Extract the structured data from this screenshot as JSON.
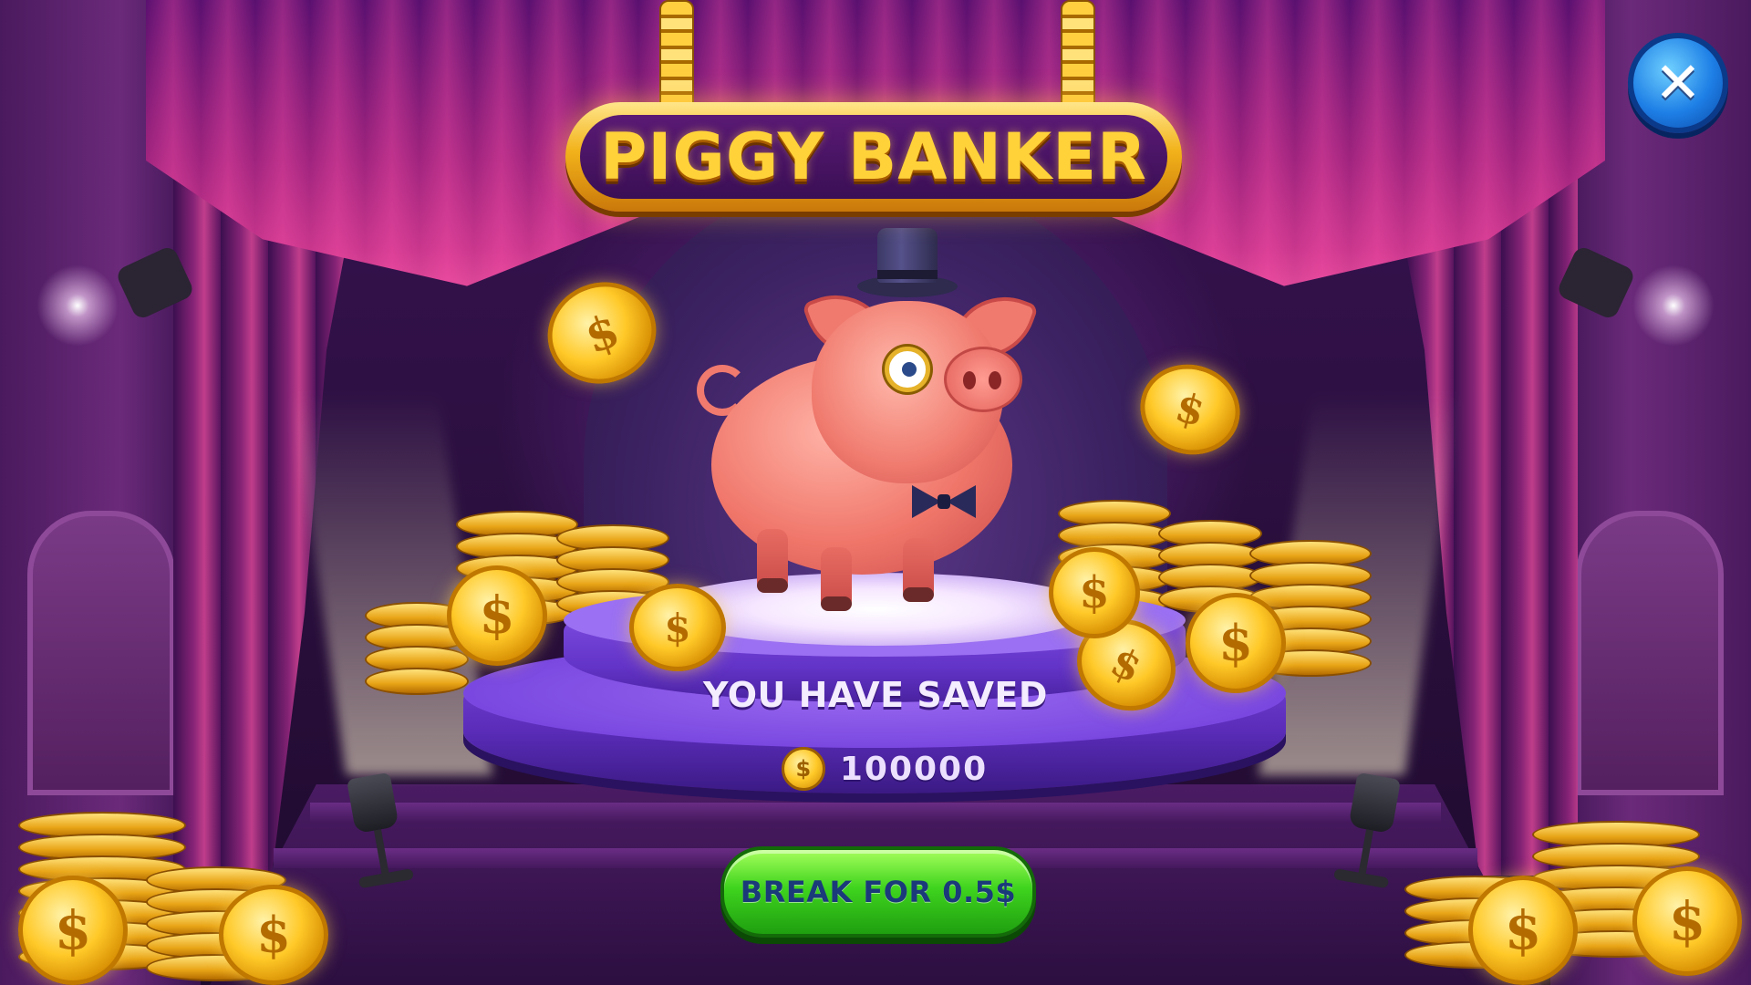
{
  "game": {
    "title": "PIGGY BANKER",
    "saved_label": "YOU HAVE SAVED",
    "saved_amount": "100000",
    "coin_symbol": "$",
    "break_button_label": "BREAK FOR 0.5$",
    "close_label": "✕"
  },
  "colors": {
    "background": "#2a0f3d",
    "title_gold": "#ffd23a",
    "pedestal_purple": "#7a48e0",
    "button_green": "#3fd41e",
    "close_blue": "#1e7fe6",
    "coin_gold": "#ffc928"
  },
  "icons": {
    "close": "close-icon",
    "coin": "coin-icon"
  }
}
